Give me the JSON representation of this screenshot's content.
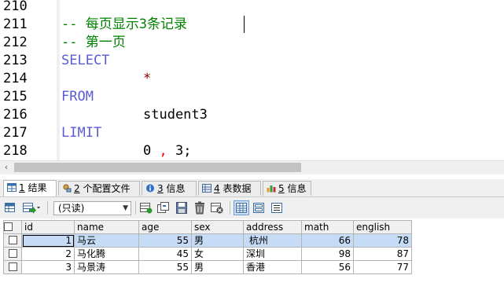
{
  "editor": {
    "lines": [
      {
        "num": "210",
        "text": ""
      },
      {
        "num": "211",
        "text": "-- 每页显示3条记录"
      },
      {
        "num": "212",
        "text": "-- 第一页"
      },
      {
        "num": "213",
        "text": "SELECT"
      },
      {
        "num": "214",
        "text": "*"
      },
      {
        "num": "215",
        "text": "FROM"
      },
      {
        "num": "216",
        "text": "student3"
      },
      {
        "num": "217",
        "text": "LIMIT"
      },
      {
        "num": "218",
        "text": "0 , 3;"
      }
    ],
    "limit_offset": "0",
    "limit_comma": ",",
    "limit_count": "3;"
  },
  "tabs": [
    {
      "num": "1",
      "label": "结果",
      "icon": "table-icon"
    },
    {
      "num": "2",
      "label": "个配置文件",
      "icon": "profile-icon"
    },
    {
      "num": "3",
      "label": "信息",
      "icon": "info-icon"
    },
    {
      "num": "4",
      "label": "表数据",
      "icon": "table-data-icon"
    },
    {
      "num": "5",
      "label": "信息",
      "icon": "chart-info-icon"
    }
  ],
  "toolbar": {
    "readonly_value": "(只读)"
  },
  "grid": {
    "columns": [
      "id",
      "name",
      "age",
      "sex",
      "address",
      "math",
      "english"
    ],
    "rows": [
      [
        "1",
        "马云",
        "55",
        "男",
        " 杭州",
        "66",
        "78"
      ],
      [
        "2",
        "马化腾",
        "45",
        "女",
        "深圳",
        "98",
        "87"
      ],
      [
        "3",
        "马景涛",
        "55",
        "男",
        "香港",
        "56",
        "77"
      ]
    ]
  },
  "colors": {
    "comment": "#008000",
    "keyword": "#5b5bd6",
    "selection": "#c6dbf5"
  }
}
